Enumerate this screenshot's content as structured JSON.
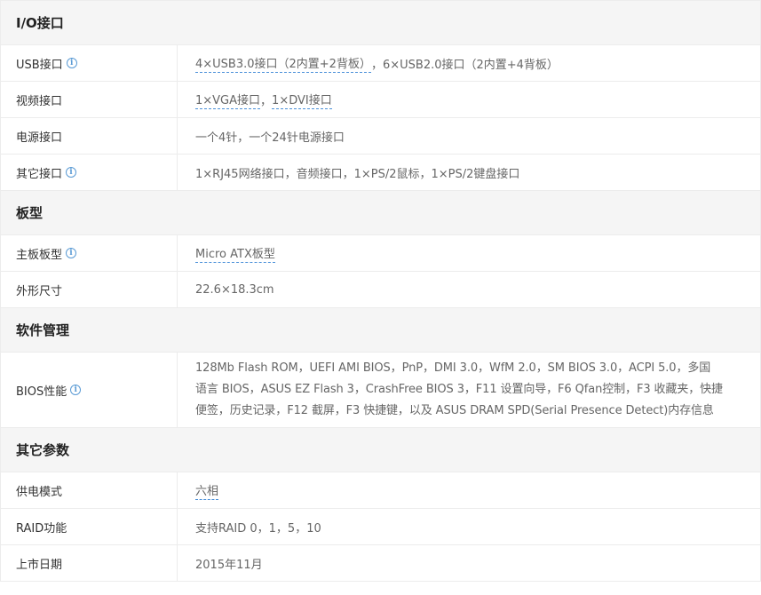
{
  "sections": [
    {
      "title": "I/O接口",
      "rows": [
        {
          "label": "USB接口",
          "info": true,
          "links": [
            "4×USB3.0接口（2内置+2背板）"
          ],
          "rest": "，6×USB2.0接口（2内置+4背板）"
        },
        {
          "label": "视频接口",
          "info": false,
          "links": [
            "1×VGA接口",
            "1×DVI接口"
          ],
          "sep": "，"
        },
        {
          "label": "电源接口",
          "info": false,
          "text": "一个4针，一个24针电源接口"
        },
        {
          "label": "其它接口",
          "info": true,
          "text": "1×RJ45网络接口，音频接口，1×PS/2鼠标，1×PS/2键盘接口"
        }
      ]
    },
    {
      "title": "板型",
      "rows": [
        {
          "label": "主板板型",
          "info": true,
          "links": [
            "Micro ATX板型"
          ]
        },
        {
          "label": "外形尺寸",
          "info": false,
          "text": "22.6×18.3cm"
        }
      ]
    },
    {
      "title": "软件管理",
      "rows": [
        {
          "label": "BIOS性能",
          "info": true,
          "lines": [
            "128Mb Flash ROM，UEFI AMI BIOS，PnP，DMI 3.0，WfM 2.0，SM BIOS 3.0，ACPI 5.0，多国",
            "语言 BIOS，ASUS EZ Flash 3，CrashFree BIOS 3，F11 设置向导，F6 Qfan控制，F3 收藏夹，快捷",
            "便签，历史记录，F12 截屏，F3 快捷键，以及 ASUS DRAM SPD(Serial Presence Detect)内存信息"
          ]
        }
      ]
    },
    {
      "title": "其它参数",
      "rows": [
        {
          "label": "供电模式",
          "info": false,
          "links": [
            "六相"
          ]
        },
        {
          "label": "RAID功能",
          "info": false,
          "text": "支持RAID 0，1，5，10"
        },
        {
          "label": "上市日期",
          "info": false,
          "text": "2015年11月"
        }
      ]
    }
  ],
  "icons": {
    "info": "info-circle-icon",
    "info_glyph": "i"
  },
  "colors": {
    "link_underline": "#4a90d9",
    "info_icon": "#5b9bd5",
    "header_bg": "#f5f5f5",
    "border": "#ececec"
  }
}
